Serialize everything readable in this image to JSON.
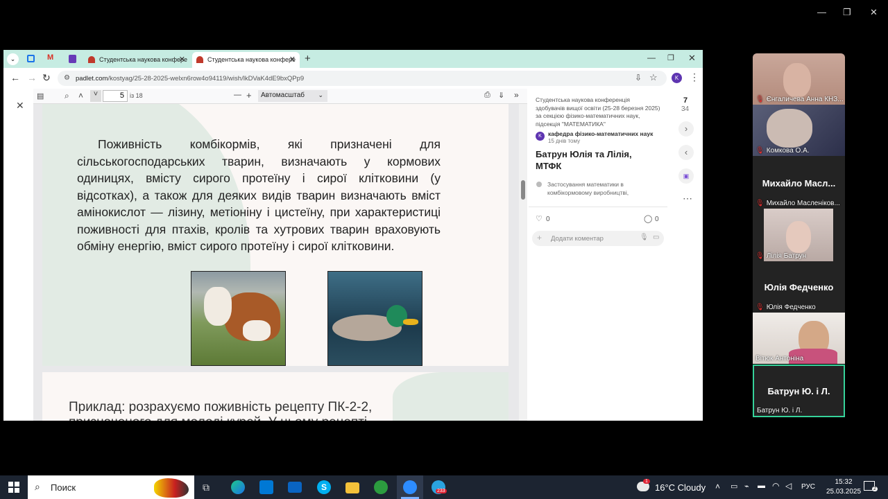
{
  "window_controls": {
    "minimize": "—",
    "restore": "❐",
    "close": "✕"
  },
  "browser": {
    "tabs": [
      {
        "label": "Студентська наукова конфере"
      },
      {
        "label": "Студентська наукова конфере"
      }
    ],
    "new_tab": "+",
    "url_host": "padlet.com",
    "url_path": "/kostyag/25-28-2025-welxn6row4o94119/wish/lkDVaK4dE9bxQPp9",
    "profile_letter": "K"
  },
  "pdf_toolbar": {
    "page_value": "5",
    "page_total": "із 18",
    "zoom_select": "Автомасштаб",
    "zoom_minus": "—",
    "zoom_plus": "+"
  },
  "pdf_page1": {
    "paragraph": "Поживність комбікормів, які призначені для сільськогосподарських тварин, визначають у кормових одиницях, вмісту сирого протеїну і сирої клітковини (у відсотках), а також для деяких видів тварин визначають вміст амінокислот — лізину, метіоніну і цистеїну,  при характеристиці поживності для птахів, кролів та хутрових тварин враховують обміну енергію, вміст сирого протеїну і сирої клітковини."
  },
  "pdf_page2": {
    "line1": "Приклад: розрахуємо поживність рецепту ПК-2-2,",
    "line2": "призначеного для молоді курей. У цьому рецепті"
  },
  "padlet": {
    "board_title": "Студентська наукова конференція здобувачів вищої освіти (25-28 березня 2025) за секцією фізико-математичних наук, підсекція \"МАТЕМАТИКА\"",
    "author_initial": "K",
    "author": "кафедра фізико-математичних наук",
    "time_ago": "15 днів тому",
    "post_title": "Батрун Юлія та Лілія, МТФК",
    "attachment": "Застосування математики в комбікормовому виробництві,",
    "likes": "0",
    "comments": "0",
    "comment_placeholder": "Додати коментар",
    "nav_current": "7",
    "nav_total": "34"
  },
  "participants": [
    {
      "name": "Єнгаличева Анна КНЗ..."
    },
    {
      "name": "Комкова О.А."
    },
    {
      "big": "Михайло  Масл...",
      "name": "Михайло Масленіков..."
    },
    {
      "name": "Лілія Батрун"
    },
    {
      "big": "Юлія Федченко",
      "name": "Юлія Федченко"
    },
    {
      "name": "Вітюк Антоніна"
    },
    {
      "big": "Батрун Ю. і Л.",
      "name": "Батрун Ю. і Л."
    }
  ],
  "taskbar": {
    "search_placeholder": "Поиск",
    "weather": "16°C  Cloudy",
    "language": "РУС",
    "time": "15:32",
    "date": "25.03.2025",
    "notifications": "2",
    "telegram_badge": "233",
    "weather_badge": "1"
  },
  "colors": {
    "tabbar": "#c6ece2",
    "taskbar": "#1c2431",
    "active_speaker": "#36d39a"
  }
}
